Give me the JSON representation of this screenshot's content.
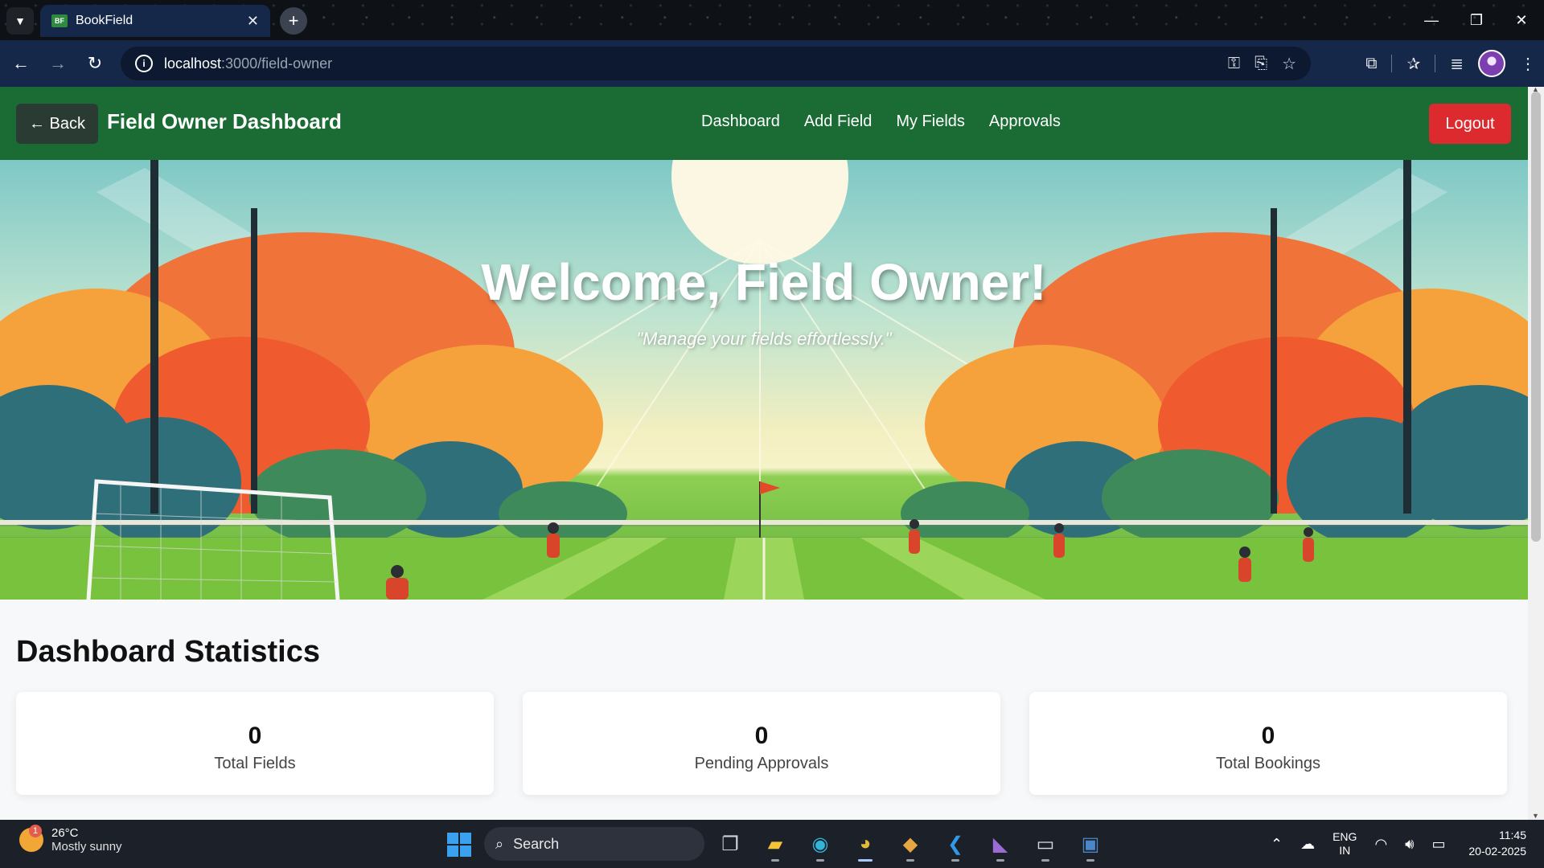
{
  "browser": {
    "tab_title": "BookField",
    "tab_favicon": "BF",
    "url_host": "localhost",
    "url_rest": ":3000/field-owner"
  },
  "app": {
    "back_label": "← Back",
    "brand": "Field Owner Dashboard",
    "menu": [
      "Dashboard",
      "Add Field",
      "My Fields",
      "Approvals"
    ],
    "logout_label": "Logout",
    "colors": {
      "nav": "#1b6b34",
      "logout": "#dc2a2e",
      "back": "#2a3b33"
    }
  },
  "hero": {
    "title": "Welcome, Field Owner!",
    "subtitle": "\"Manage your fields effortlessly.\""
  },
  "stats": {
    "title": "Dashboard Statistics",
    "cards": [
      {
        "value": "0",
        "label": "Total Fields"
      },
      {
        "value": "0",
        "label": "Pending Approvals"
      },
      {
        "value": "0",
        "label": "Total Bookings"
      }
    ]
  },
  "taskbar": {
    "weather_temp": "26°C",
    "weather_cond": "Mostly sunny",
    "weather_badge": "1",
    "search_label": "Search",
    "lang_top": "ENG",
    "lang_bottom": "IN",
    "time": "11:45",
    "date": "20-02-2025"
  }
}
